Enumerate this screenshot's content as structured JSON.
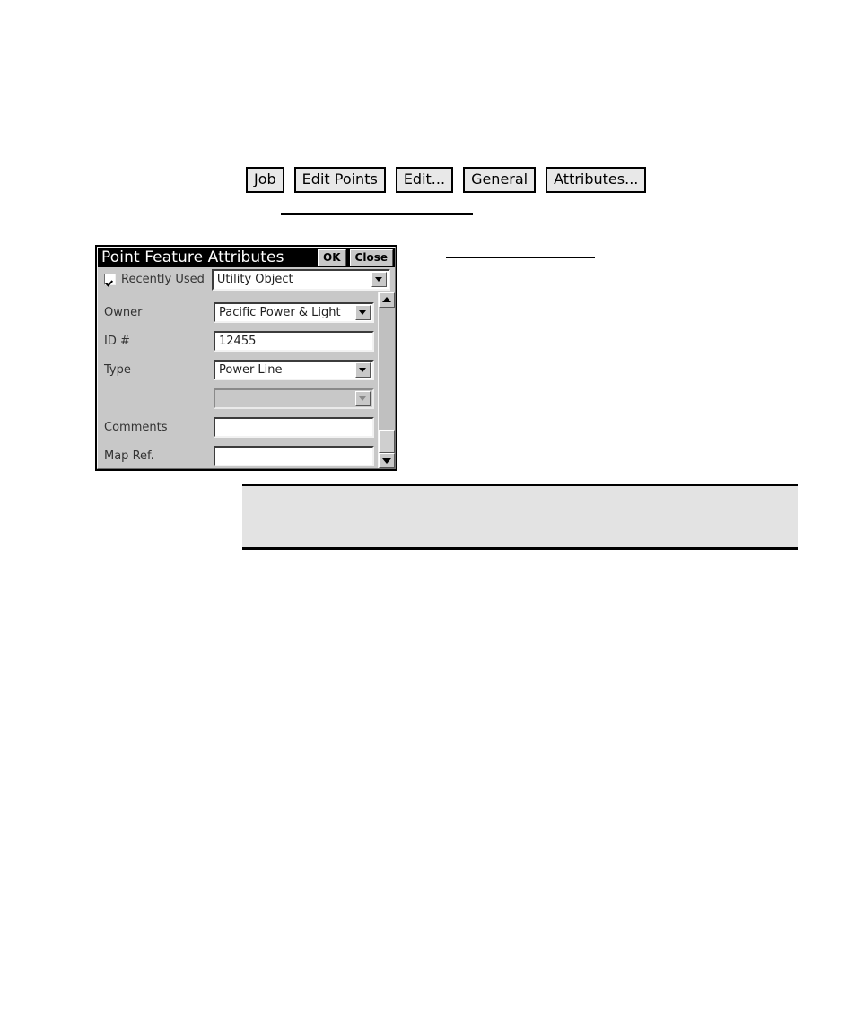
{
  "toolbar": {
    "buttons": [
      {
        "label": "Job"
      },
      {
        "label": "Edit Points"
      },
      {
        "label": "Edit..."
      },
      {
        "label": "General"
      },
      {
        "label": "Attributes..."
      }
    ]
  },
  "dialog": {
    "title": "Point Feature Attributes",
    "ok_label": "OK",
    "close_label": "Close",
    "recently_used": {
      "label": "Recently Used",
      "checked": true
    },
    "feature_combo": {
      "value": "Utility Object"
    },
    "fields": [
      {
        "label": "Owner",
        "type": "combo",
        "value": "Pacific Power & Light",
        "disabled": false
      },
      {
        "label": "ID #",
        "type": "textinput",
        "value": "12455",
        "disabled": false
      },
      {
        "label": "Type",
        "type": "combo",
        "value": "Power Line",
        "disabled": false
      },
      {
        "label": "",
        "type": "combo",
        "value": "",
        "disabled": true
      },
      {
        "label": "Comments",
        "type": "textinput",
        "value": "",
        "disabled": false
      },
      {
        "label": "Map Ref.",
        "type": "textinput",
        "value": "",
        "disabled": false
      }
    ]
  },
  "annotations": {
    "rule_top": "",
    "rule_right": "",
    "callout_text": ""
  }
}
